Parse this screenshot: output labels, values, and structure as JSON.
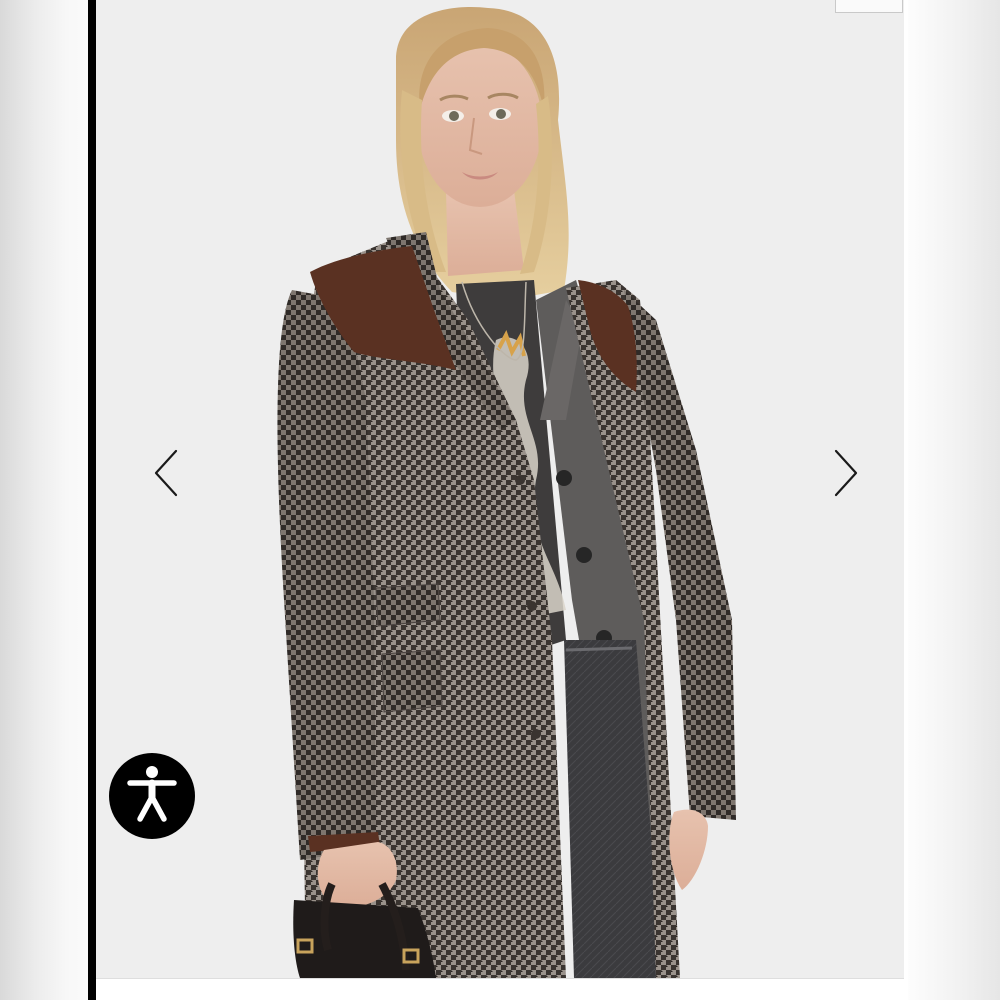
{
  "gallery": {
    "image_alt": "",
    "prev_icon": "chevron-left-icon",
    "next_icon": "chevron-right-icon"
  },
  "accessibility": {
    "icon": "accessibility-person-icon",
    "background_color": "#000000",
    "icon_color": "#ffffff"
  },
  "colors": {
    "stage_background": "#eeeeee",
    "frame_rule": "#000000"
  }
}
